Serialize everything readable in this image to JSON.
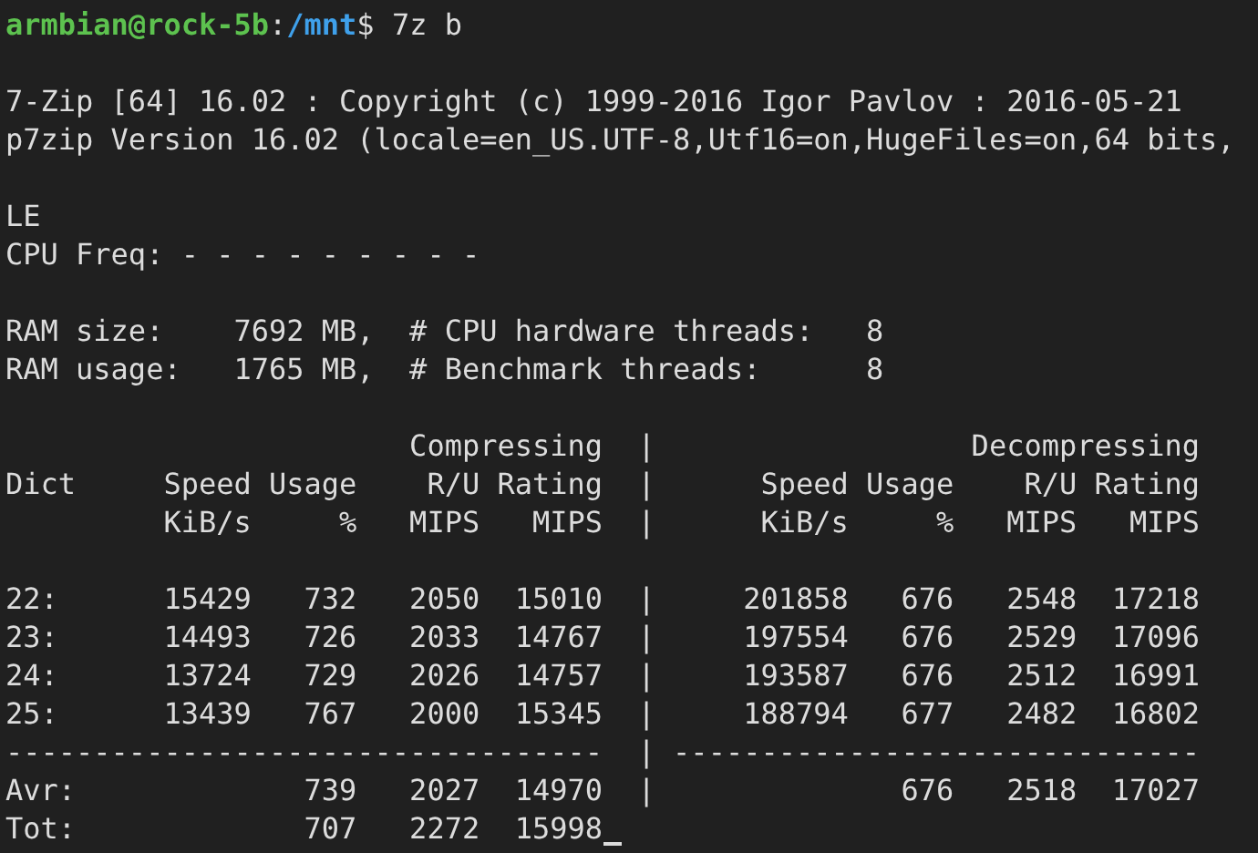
{
  "prompt": {
    "user_host": "armbian@rock-5b",
    "separator": ":",
    "path": "/mnt",
    "symbol": "$",
    "command": " 7z b"
  },
  "blocks": [
    [
      "7-Zip [64] 16.02 : Copyright (c) 1999-2016 Igor Pavlov : 2016-05-21",
      "p7zip Version 16.02 (locale=en_US.UTF-8,Utf16=on,HugeFiles=on,64 bits,"
    ],
    [
      "LE",
      "CPU Freq: - - - - - - - - -"
    ],
    [
      "RAM size:    7692 MB,  # CPU hardware threads:   8",
      "RAM usage:   1765 MB,  # Benchmark threads:      8"
    ],
    [
      "                       Compressing  |                  Decompressing",
      "Dict     Speed Usage    R/U Rating  |      Speed Usage    R/U Rating",
      "         KiB/s     %   MIPS   MIPS  |      KiB/s     %   MIPS   MIPS"
    ],
    [
      "22:      15429   732   2050  15010  |     201858   676   2548  17218",
      "23:      14493   726   2033  14767  |     197554   676   2529  17096",
      "24:      13724   729   2026  14757  |     193587   676   2512  16991",
      "25:      13439   767   2000  15345  |     188794   677   2482  16802",
      "----------------------------------  | ------------------------------",
      "Avr:             739   2027  14970  |              676   2518  17027",
      "Tot:             707   2272  15998"
    ]
  ]
}
